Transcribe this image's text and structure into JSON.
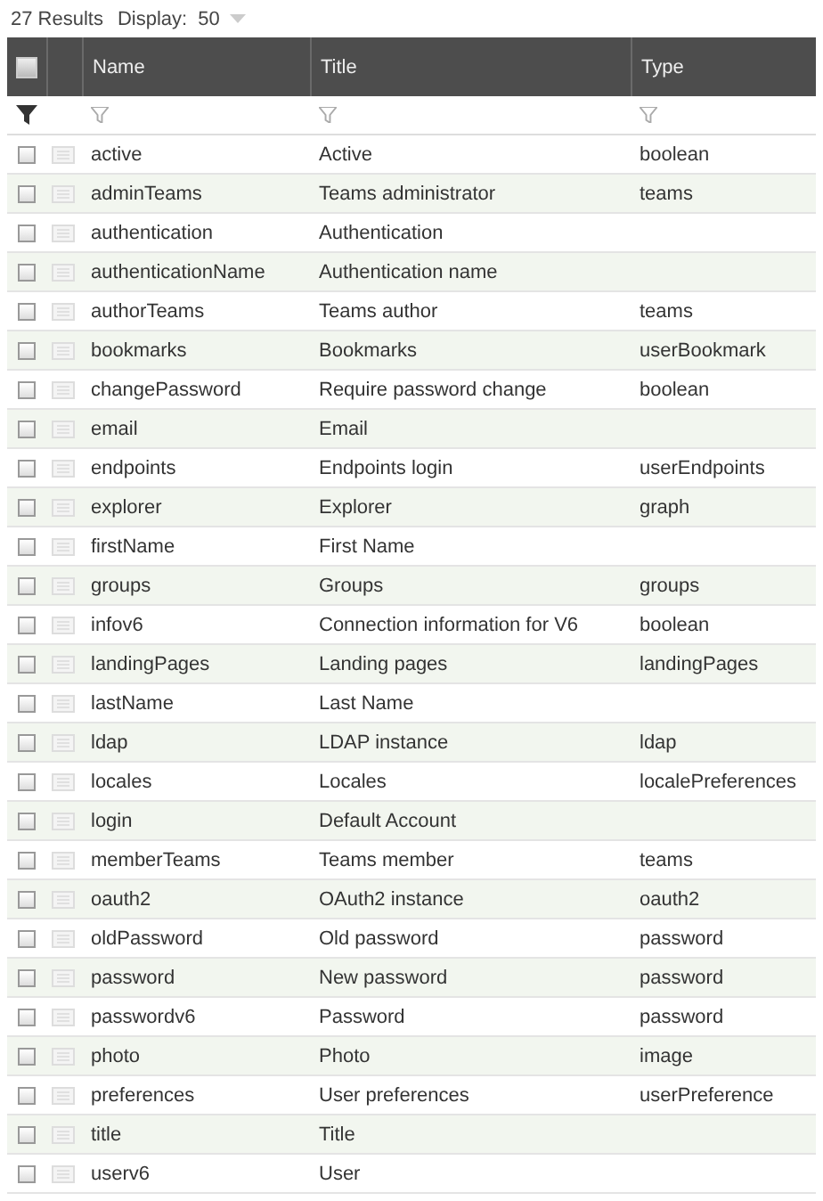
{
  "toolbar": {
    "results": "27 Results",
    "display_label": "Display:",
    "display_value": "50"
  },
  "table": {
    "select_all": {
      "checked": false
    },
    "columns": [
      "Name",
      "Title",
      "Type"
    ],
    "rows": [
      {
        "name": "active",
        "title": "Active",
        "type": "boolean",
        "checked": false
      },
      {
        "name": "adminTeams",
        "title": "Teams administrator",
        "type": "teams",
        "checked": false
      },
      {
        "name": "authentication",
        "title": "Authentication",
        "type": "",
        "checked": false
      },
      {
        "name": "authenticationName",
        "title": "Authentication name",
        "type": "",
        "checked": false
      },
      {
        "name": "authorTeams",
        "title": "Teams author",
        "type": "teams",
        "checked": false
      },
      {
        "name": "bookmarks",
        "title": "Bookmarks",
        "type": "userBookmark",
        "checked": false
      },
      {
        "name": "changePassword",
        "title": "Require password change",
        "type": "boolean",
        "checked": false
      },
      {
        "name": "email",
        "title": "Email",
        "type": "",
        "checked": false
      },
      {
        "name": "endpoints",
        "title": "Endpoints login",
        "type": "userEndpoints",
        "checked": false
      },
      {
        "name": "explorer",
        "title": "Explorer",
        "type": "graph",
        "checked": false
      },
      {
        "name": "firstName",
        "title": "First Name",
        "type": "",
        "checked": false
      },
      {
        "name": "groups",
        "title": "Groups",
        "type": "groups",
        "checked": false
      },
      {
        "name": "infov6",
        "title": "Connection information for V6",
        "type": "boolean",
        "checked": false
      },
      {
        "name": "landingPages",
        "title": "Landing pages",
        "type": "landingPages",
        "checked": false
      },
      {
        "name": "lastName",
        "title": "Last Name",
        "type": "",
        "checked": false
      },
      {
        "name": "ldap",
        "title": "LDAP instance",
        "type": "ldap",
        "checked": false
      },
      {
        "name": "locales",
        "title": "Locales",
        "type": "localePreferences",
        "checked": false
      },
      {
        "name": "login",
        "title": "Default Account",
        "type": "",
        "checked": false
      },
      {
        "name": "memberTeams",
        "title": "Teams member",
        "type": "teams",
        "checked": false
      },
      {
        "name": "oauth2",
        "title": "OAuth2 instance",
        "type": "oauth2",
        "checked": false
      },
      {
        "name": "oldPassword",
        "title": "Old password",
        "type": "password",
        "checked": false
      },
      {
        "name": "password",
        "title": "New password",
        "type": "password",
        "checked": false
      },
      {
        "name": "passwordv6",
        "title": "Password",
        "type": "password",
        "checked": false
      },
      {
        "name": "photo",
        "title": "Photo",
        "type": "image",
        "checked": false
      },
      {
        "name": "preferences",
        "title": "User preferences",
        "type": "userPreference",
        "checked": false
      },
      {
        "name": "title",
        "title": "Title",
        "type": "",
        "checked": false
      },
      {
        "name": "userv6",
        "title": "User",
        "type": "",
        "checked": false
      }
    ]
  }
}
